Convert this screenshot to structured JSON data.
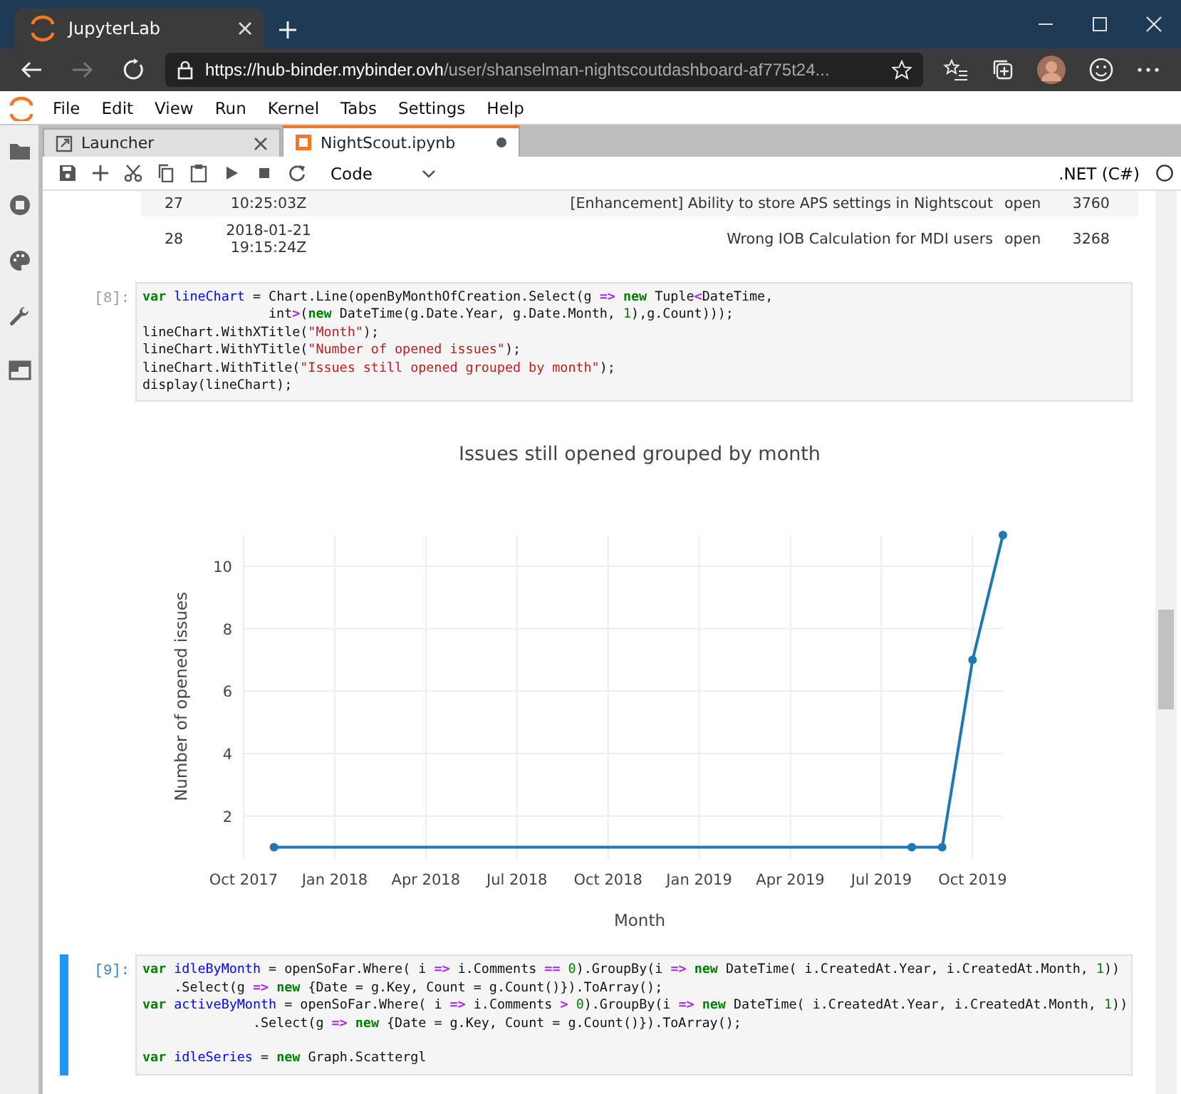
{
  "browser": {
    "tab_title": "JupyterLab",
    "url_host": "https://hub-binder.mybinder.ovh",
    "url_path": "/user/shanselman-nightscoutdashboard-af775t24..."
  },
  "menu": [
    "File",
    "Edit",
    "View",
    "Run",
    "Kernel",
    "Tabs",
    "Settings",
    "Help"
  ],
  "tabs": [
    {
      "label": "Launcher",
      "selected": false,
      "unsaved": false
    },
    {
      "label": "NightScout.ipynb",
      "selected": true,
      "unsaved": true
    }
  ],
  "toolbar": {
    "cell_type": "Code",
    "kernel": ".NET (C#)"
  },
  "table_rows": [
    {
      "number": "27",
      "created_time": "10:25:03Z",
      "title": "[Enhancement] Ability to store APS settings in Nightscout",
      "state": "open",
      "comments": "3760"
    },
    {
      "number": "28",
      "created_date": "2018-01-21",
      "created_time": "19:15:24Z",
      "title": "Wrong IOB Calculation for MDI users",
      "state": "open",
      "comments": "3268"
    }
  ],
  "cells": [
    {
      "prompt": "[8]:",
      "active": false,
      "lines": [
        {
          "segments": [
            {
              "kind": "keyword",
              "text": "var"
            },
            {
              "kind": "name",
              "text": " lineChart"
            },
            {
              "kind": "plain",
              "text": " = Chart.Line(openByMonthOfCreation.Select(g "
            },
            {
              "kind": "operator",
              "text": "=>"
            },
            {
              "kind": "keyword",
              "text": " new"
            },
            {
              "kind": "plain",
              "text": " Tuple"
            },
            {
              "kind": "operator",
              "text": "<"
            },
            {
              "kind": "plain",
              "text": "DateTime,"
            }
          ]
        },
        {
          "segments": [
            {
              "kind": "plain",
              "text": "                int"
            },
            {
              "kind": "operator",
              "text": ">"
            },
            {
              "kind": "plain",
              "text": "("
            },
            {
              "kind": "keyword",
              "text": "new"
            },
            {
              "kind": "plain",
              "text": " DateTime(g.Date.Year, g.Date.Month, "
            },
            {
              "kind": "number",
              "text": "1"
            },
            {
              "kind": "plain",
              "text": "),g.Count)));"
            }
          ]
        },
        {
          "segments": [
            {
              "kind": "plain",
              "text": "lineChart.WithXTitle("
            },
            {
              "kind": "string",
              "text": "\"Month\""
            },
            {
              "kind": "plain",
              "text": ");"
            }
          ]
        },
        {
          "segments": [
            {
              "kind": "plain",
              "text": "lineChart.WithYTitle("
            },
            {
              "kind": "string",
              "text": "\"Number of opened issues\""
            },
            {
              "kind": "plain",
              "text": ");"
            }
          ]
        },
        {
          "segments": [
            {
              "kind": "plain",
              "text": "lineChart.WithTitle("
            },
            {
              "kind": "string",
              "text": "\"Issues still opened grouped by month\""
            },
            {
              "kind": "plain",
              "text": ");"
            }
          ]
        },
        {
          "segments": [
            {
              "kind": "plain",
              "text": "display(lineChart);"
            }
          ]
        }
      ],
      "output": {
        "chart_data": {
          "type": "line",
          "title": "Issues still opened grouped by month",
          "xlabel": "Month",
          "ylabel": "Number of opened issues",
          "x": [
            "2017-11",
            "2019-08",
            "2019-09",
            "2019-10",
            "2019-11"
          ],
          "series": [
            {
              "color": "#1f77b4",
              "marker": true,
              "values": [
                1,
                1,
                1,
                7,
                11
              ]
            }
          ],
          "xlim": [
            "2017-10",
            "2019-11"
          ],
          "ylim": [
            0.6,
            11
          ],
          "grid": true,
          "xticks": [
            {
              "value": "2017-10",
              "label": "Oct 2017"
            },
            {
              "value": "2018-01",
              "label": "Jan 2018"
            },
            {
              "value": "2018-04",
              "label": "Apr 2018"
            },
            {
              "value": "2018-07",
              "label": "Jul 2018"
            },
            {
              "value": "2018-10",
              "label": "Oct 2018"
            },
            {
              "value": "2019-01",
              "label": "Jan 2019"
            },
            {
              "value": "2019-04",
              "label": "Apr 2019"
            },
            {
              "value": "2019-07",
              "label": "Jul 2019"
            },
            {
              "value": "2019-10",
              "label": "Oct 2019"
            }
          ],
          "yticks": [
            2,
            4,
            6,
            8,
            10
          ]
        }
      }
    },
    {
      "prompt": "[9]:",
      "active": true,
      "lines": [
        {
          "segments": [
            {
              "kind": "keyword",
              "text": "var"
            },
            {
              "kind": "name",
              "text": " idleByMonth"
            },
            {
              "kind": "plain",
              "text": " = openSoFar.Where( i "
            },
            {
              "kind": "operator",
              "text": "=>"
            },
            {
              "kind": "plain",
              "text": " i.Comments "
            },
            {
              "kind": "operator",
              "text": "=="
            },
            {
              "kind": "number",
              "text": " 0"
            },
            {
              "kind": "plain",
              "text": ").GroupBy(i "
            },
            {
              "kind": "operator",
              "text": "=>"
            },
            {
              "kind": "keyword",
              "text": " new"
            },
            {
              "kind": "plain",
              "text": " DateTime( i.CreatedAt.Year, i.CreatedAt.Month, "
            },
            {
              "kind": "number",
              "text": "1"
            },
            {
              "kind": "plain",
              "text": "))"
            }
          ]
        },
        {
          "segments": [
            {
              "kind": "plain",
              "text": "    .Select(g "
            },
            {
              "kind": "operator",
              "text": "=>"
            },
            {
              "kind": "keyword",
              "text": " new"
            },
            {
              "kind": "plain",
              "text": " {Date = g.Key, Count = g.Count()}).ToArray();"
            }
          ]
        },
        {
          "segments": [
            {
              "kind": "keyword",
              "text": "var"
            },
            {
              "kind": "name",
              "text": " activeByMonth"
            },
            {
              "kind": "plain",
              "text": " = openSoFar.Where( i "
            },
            {
              "kind": "operator",
              "text": "=>"
            },
            {
              "kind": "plain",
              "text": " i.Comments "
            },
            {
              "kind": "operator",
              "text": ">"
            },
            {
              "kind": "number",
              "text": " 0"
            },
            {
              "kind": "plain",
              "text": ").GroupBy(i "
            },
            {
              "kind": "operator",
              "text": "=>"
            },
            {
              "kind": "keyword",
              "text": " new"
            },
            {
              "kind": "plain",
              "text": " DateTime( i.CreatedAt.Year, i.CreatedAt.Month, "
            },
            {
              "kind": "number",
              "text": "1"
            },
            {
              "kind": "plain",
              "text": "))"
            }
          ]
        },
        {
          "segments": [
            {
              "kind": "plain",
              "text": "              .Select(g "
            },
            {
              "kind": "operator",
              "text": "=>"
            },
            {
              "kind": "keyword",
              "text": " new"
            },
            {
              "kind": "plain",
              "text": " {Date = g.Key, Count = g.Count()}).ToArray();"
            }
          ]
        },
        {
          "blank_line_before": true,
          "segments": [
            {
              "kind": "keyword",
              "text": "var"
            },
            {
              "kind": "name",
              "text": " idleSeries"
            },
            {
              "kind": "plain",
              "text": " = "
            },
            {
              "kind": "keyword",
              "text": "new"
            },
            {
              "kind": "plain",
              "text": " Graph.Scattergl"
            }
          ]
        }
      ]
    }
  ]
}
